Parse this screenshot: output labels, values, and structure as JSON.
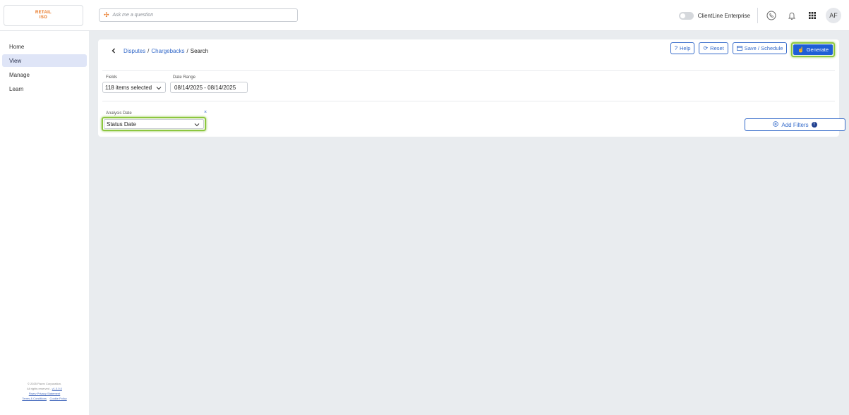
{
  "logo": {
    "line1": "RETAIL",
    "line2": "ISO"
  },
  "ask": {
    "placeholder": "Ask me a question"
  },
  "topbar": {
    "enterprise_label": "ClientLine Enterprise",
    "avatar_initials": "AF"
  },
  "sidebar": {
    "items": [
      {
        "label": "Home"
      },
      {
        "label": "View"
      },
      {
        "label": "Manage"
      },
      {
        "label": "Learn"
      }
    ],
    "footer": {
      "line1": "© 2025 Fiserv Corporation.",
      "line2_prefix": "All rights reserved - ",
      "line2_link": "v1.0.0.0",
      "line3": "Fiserv Privacy Statement",
      "line4_a": "Terms & Conditions",
      "line4_b": "Cookie Policy"
    }
  },
  "breadcrumb": {
    "parts": [
      "Disputes",
      "Chargebacks",
      "Search"
    ],
    "separator": "/"
  },
  "actions": {
    "help": "Help",
    "reset": "Reset",
    "save_schedule": "Save / Schedule",
    "generate": "Generate"
  },
  "fields": {
    "fields_label": "Fields",
    "fields_value": "118 items selected",
    "date_range_label": "Date Range",
    "date_range_value": "08/14/2025 - 08/14/2025",
    "analysis_label": "Analysis Date",
    "analysis_value": "Status Date",
    "clear_symbol": "×"
  },
  "add_filters": {
    "label": "Add Filters",
    "badge": "!"
  },
  "colors": {
    "accent": "#1f5fd6",
    "highlight": "#8cc63f",
    "brand": "#e8741f"
  }
}
